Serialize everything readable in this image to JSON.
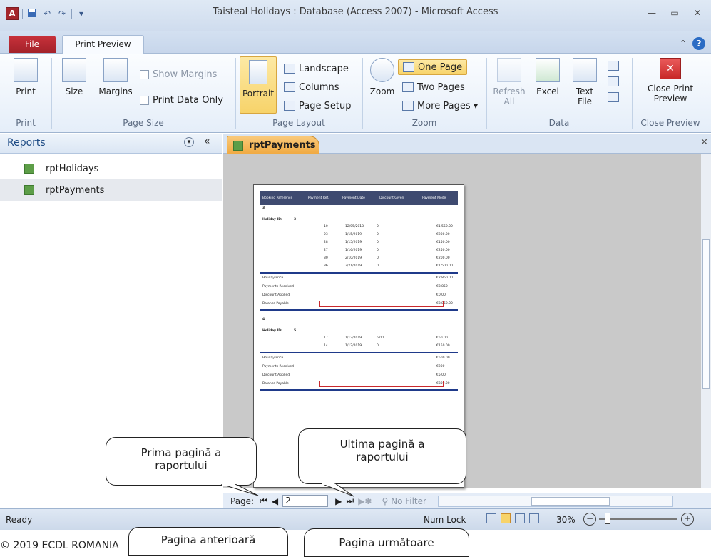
{
  "window": {
    "title": "Taisteal Holidays : Database (Access 2007)  -  Microsoft Access"
  },
  "qat": {
    "logo": "A",
    "undo": "↶",
    "redo": "↷",
    "customize": "▾"
  },
  "winctl": {
    "minimize": "—",
    "restore": "▭",
    "close": "✕"
  },
  "tabs": {
    "file": "File",
    "print_preview": "Print Preview"
  },
  "help": {
    "collapse": "⌃",
    "help": "?"
  },
  "ribbon": {
    "print": {
      "print": "Print",
      "label": "Print"
    },
    "page_size": {
      "size": "Size",
      "margins": "Margins",
      "show_margins": "Show Margins",
      "print_data_only": "Print Data Only",
      "label": "Page Size"
    },
    "page_layout": {
      "portrait": "Portrait",
      "landscape": "Landscape",
      "columns": "Columns",
      "page_setup": "Page Setup",
      "label": "Page Layout"
    },
    "zoom": {
      "zoom": "Zoom",
      "one_page": "One Page",
      "two_pages": "Two Pages",
      "more_pages": "More Pages ▾",
      "label": "Zoom"
    },
    "data": {
      "refresh": "Refresh",
      "refresh2": "All",
      "excel": "Excel",
      "text_file": "Text",
      "text_file2": "File",
      "label": "Data"
    },
    "close": {
      "close_print": "Close Print",
      "close_print2": "Preview",
      "label": "Close Preview"
    }
  },
  "nav": {
    "title": "Reports",
    "items": [
      "rptHolidays",
      "rptPayments"
    ]
  },
  "doc": {
    "tab": "rptPayments",
    "close": "✕"
  },
  "report": {
    "headers": [
      "Booking Reference",
      "Payment Ref.",
      "Payment Date",
      "Discount Given",
      "Payment Mode"
    ],
    "groups": [
      {
        "booking": "3",
        "holiday_label": "Holiday ID:",
        "holiday_id": "3",
        "rows": [
          [
            "10",
            "12/05/2018",
            "0",
            "€1,550.00"
          ],
          [
            "23",
            "1/15/2019",
            "0",
            "€200.00"
          ],
          [
            "28",
            "1/15/2019",
            "0",
            "€150.00"
          ],
          [
            "27",
            "1/16/2019",
            "0",
            "€250.00"
          ],
          [
            "30",
            "2/10/2019",
            "0",
            "€200.00"
          ],
          [
            "36",
            "3/21/2019",
            "0",
            "€1,500.00"
          ]
        ],
        "summary": [
          [
            "Holiday Price",
            "€2,850.00"
          ],
          [
            "Payments Received",
            "€3,850"
          ],
          [
            "Discount Applied",
            "€0.00"
          ],
          [
            "Balance Payable",
            "€3,850.00"
          ]
        ]
      },
      {
        "booking": "4",
        "holiday_label": "Holiday ID:",
        "holiday_id": "5",
        "rows": [
          [
            "17",
            "1/12/2019",
            "5.00",
            "€50.00"
          ],
          [
            "14",
            "1/12/2019",
            "0",
            "€150.00"
          ]
        ],
        "summary": [
          [
            "Holiday Price",
            "€500.00"
          ],
          [
            "Payments Received",
            "€200"
          ],
          [
            "Discount Applied",
            "€5.00"
          ],
          [
            "Balance Payable",
            "€300.00"
          ]
        ]
      }
    ]
  },
  "navbar": {
    "page_label": "Page:",
    "page_value": "2",
    "filter": "No Filter"
  },
  "status": {
    "ready": "Ready",
    "numlock": "Num Lock",
    "zoom": "30%"
  },
  "callouts": {
    "first": "Prima pagină a raportului",
    "last": "Ultima pagină a raportului",
    "prev": "Pagina anterioară",
    "next": "Pagina următoare"
  },
  "footer": {
    "copyright": "© 2019 ECDL ROMANIA"
  }
}
